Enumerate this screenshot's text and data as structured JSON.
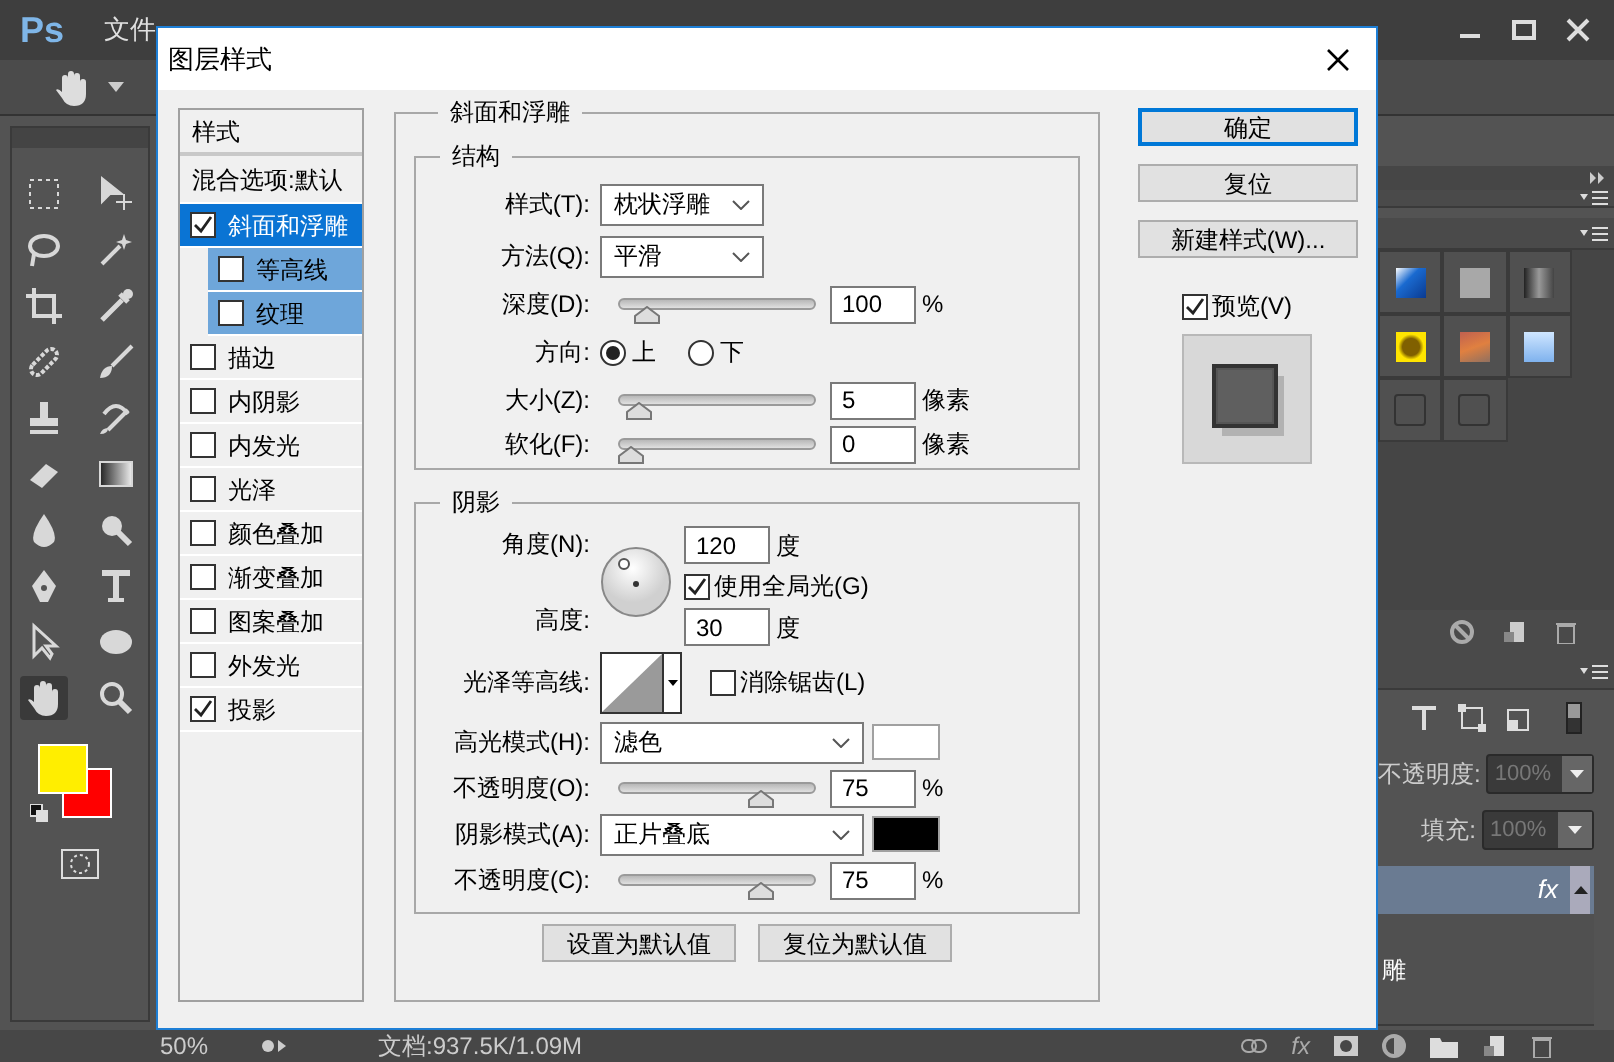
{
  "app": {
    "logo": "Ps",
    "menu": [
      "文件"
    ]
  },
  "dialog": {
    "title": "图层样式",
    "styles_header": "样式",
    "blend_options": "混合选项:默认",
    "styles": [
      {
        "label": "斜面和浮雕",
        "checked": true,
        "selected": true,
        "children": [
          {
            "label": "等高线",
            "checked": false,
            "selected": false
          },
          {
            "label": "纹理",
            "checked": false,
            "selected": false
          }
        ]
      },
      {
        "label": "描边",
        "checked": false,
        "selected": false
      },
      {
        "label": "内阴影",
        "checked": false,
        "selected": false
      },
      {
        "label": "内发光",
        "checked": false,
        "selected": false
      },
      {
        "label": "光泽",
        "checked": false,
        "selected": false
      },
      {
        "label": "颜色叠加",
        "checked": false,
        "selected": false
      },
      {
        "label": "渐变叠加",
        "checked": false,
        "selected": false
      },
      {
        "label": "图案叠加",
        "checked": false,
        "selected": false
      },
      {
        "label": "外发光",
        "checked": false,
        "selected": false
      },
      {
        "label": "投影",
        "checked": true,
        "selected": false
      }
    ],
    "bevel": {
      "title": "斜面和浮雕",
      "structure": {
        "title": "结构",
        "style": {
          "label": "样式(T):",
          "value": "枕状浮雕"
        },
        "technique": {
          "label": "方法(Q):",
          "value": "平滑"
        },
        "depth": {
          "label": "深度(D):",
          "level": 0.09,
          "value": "100",
          "unit": "%"
        },
        "direction": {
          "label": "方向:",
          "options": [
            {
              "label": "上",
              "selected": true
            },
            {
              "label": "下",
              "selected": false
            }
          ]
        },
        "size": {
          "label": "大小(Z):",
          "level": 0.05,
          "value": "5",
          "unit": "像素"
        },
        "soften": {
          "label": "软化(F):",
          "level": 0,
          "value": "0",
          "unit": "像素"
        }
      },
      "shading": {
        "title": "阴影",
        "angle": {
          "label": "角度(N):",
          "value": "120",
          "unit": "度"
        },
        "global_light": {
          "label": "使用全局光(G)",
          "checked": true
        },
        "altitude": {
          "label": "高度:",
          "value": "30",
          "unit": "度"
        },
        "gloss_contour": {
          "label": "光泽等高线:"
        },
        "anti_aliased": {
          "label": "消除锯齿(L)",
          "checked": false
        },
        "highlight_mode": {
          "label": "高光模式(H):",
          "value": "滤色",
          "color": "#ffffff"
        },
        "highlight_opacity": {
          "label": "不透明度(O):",
          "level": 0.75,
          "value": "75",
          "unit": "%"
        },
        "shadow_mode": {
          "label": "阴影模式(A):",
          "value": "正片叠底",
          "color": "#000000"
        },
        "shadow_opacity": {
          "label": "不透明度(C):",
          "level": 0.75,
          "value": "75",
          "unit": "%"
        }
      },
      "buttons": [
        "设置为默认值",
        "复位为默认值"
      ]
    },
    "actions": [
      {
        "label": "确定",
        "selected": true
      },
      {
        "label": "复位",
        "selected": false
      },
      {
        "label": "新建样式(W)...",
        "selected": false
      }
    ],
    "preview": {
      "label": "预览(V)",
      "checked": true
    }
  },
  "layers": {
    "opacity": {
      "label": "不透明度:",
      "value": "100%",
      "disabled": true
    },
    "fill": {
      "label": "填充:",
      "value": "100%",
      "disabled": true
    },
    "layer": {
      "name": "雕",
      "fx": "fx"
    },
    "toolbar_fx": "fx"
  },
  "status": {
    "zoom": "50%",
    "document": "文档:937.5K/1.09M"
  }
}
